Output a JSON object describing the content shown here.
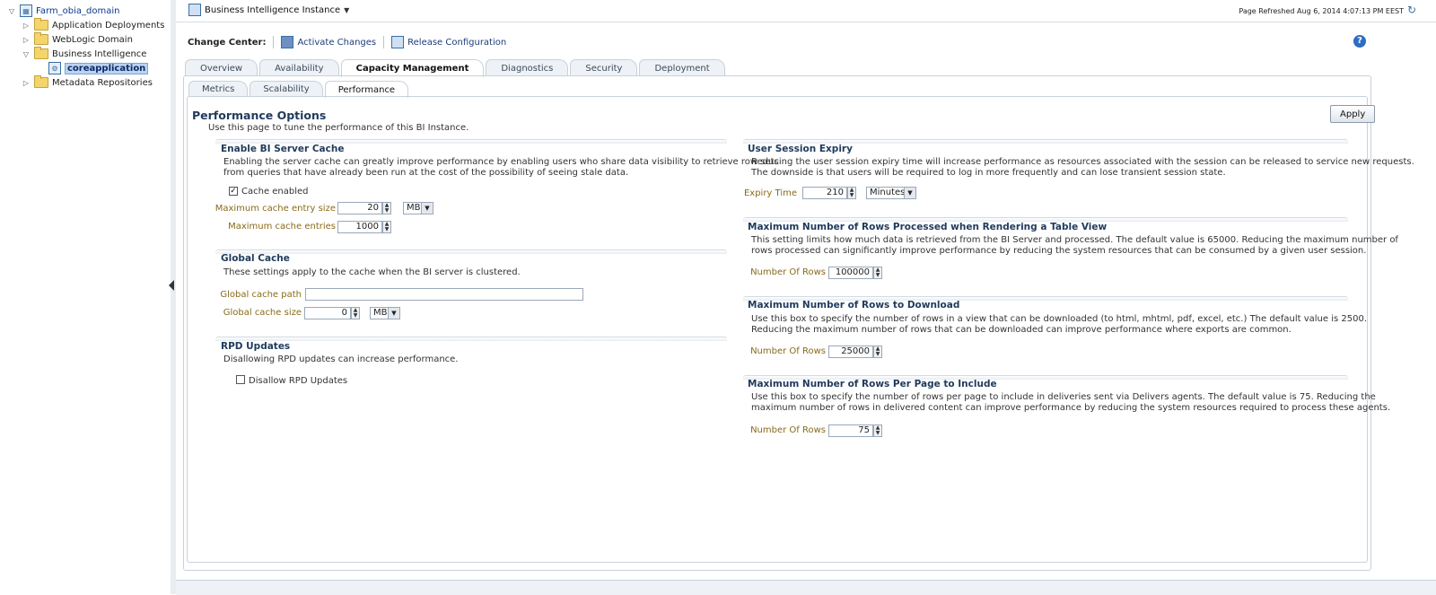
{
  "tree": {
    "root": "Farm_obia_domain",
    "items": [
      "Application Deployments",
      "WebLogic Domain",
      "Business Intelligence",
      "coreapplication",
      "Metadata Repositories"
    ]
  },
  "header": {
    "instance_menu": "Business Intelligence Instance",
    "page_refreshed": "Page Refreshed Aug 6, 2014 4:07:13 PM EEST"
  },
  "change_center": {
    "label": "Change Center:",
    "activate": "Activate Changes",
    "release": "Release Configuration"
  },
  "tabs": [
    "Overview",
    "Availability",
    "Capacity Management",
    "Diagnostics",
    "Security",
    "Deployment"
  ],
  "subtabs": [
    "Metrics",
    "Scalability",
    "Performance"
  ],
  "page": {
    "title": "Performance Options",
    "description": "Use this page to tune the performance of this BI Instance.",
    "apply": "Apply"
  },
  "bi_cache": {
    "title": "Enable BI Server Cache",
    "desc1": "Enabling the server cache can greatly improve performance by enabling users who share data visibility to retrieve row sets",
    "desc2": "from queries that have already been run at the cost of the possibility of seeing stale data.",
    "cache_enabled_label": "Cache enabled",
    "max_entry_size_label": "Maximum cache entry size",
    "max_entry_size": "20",
    "max_entry_unit": "MB",
    "max_entries_label": "Maximum cache entries",
    "max_entries": "1000"
  },
  "global_cache": {
    "title": "Global Cache",
    "desc": "These settings apply to the cache when the BI server is clustered.",
    "path_label": "Global cache path",
    "path_value": "",
    "size_label": "Global cache size",
    "size_value": "0",
    "size_unit": "MB"
  },
  "rpd": {
    "title": "RPD Updates",
    "desc": "Disallowing RPD updates can increase performance.",
    "disallow_label": "Disallow RPD Updates"
  },
  "session_expiry": {
    "title": "User Session Expiry",
    "desc1": "Reducing the user session expiry time will increase performance as resources associated with the session can be released to service new requests.",
    "desc2": "The downside is that users will be required to log in more frequently and can lose transient session state.",
    "expiry_label": "Expiry Time",
    "expiry_value": "210",
    "expiry_unit": "Minutes"
  },
  "rows_table": {
    "title": "Maximum Number of Rows Processed when Rendering a Table View",
    "desc1": "This setting limits how much data is retrieved from the BI Server and processed. The default value is 65000. Reducing the maximum number of",
    "desc2": "rows processed can significantly improve performance by reducing the system resources that can be consumed by a given user session.",
    "label": "Number Of Rows",
    "value": "100000"
  },
  "rows_download": {
    "title": "Maximum Number of Rows to Download",
    "desc1": "Use this box to specify the number of rows in a view that can be downloaded (to html, mhtml, pdf, excel, etc.) The default value is 2500.",
    "desc2": "Reducing the maximum number of rows that can be downloaded can improve performance where exports are common.",
    "label": "Number Of Rows",
    "value": "25000"
  },
  "rows_page": {
    "title": "Maximum Number of Rows Per Page to Include",
    "desc1": "Use this box to specify the number of rows per page to include in deliveries sent via Delivers agents. The default value is 75. Reducing the",
    "desc2": "maximum number of rows in delivered content can improve performance by reducing the system resources required to process these agents.",
    "label": "Number Of Rows",
    "value": "75"
  }
}
